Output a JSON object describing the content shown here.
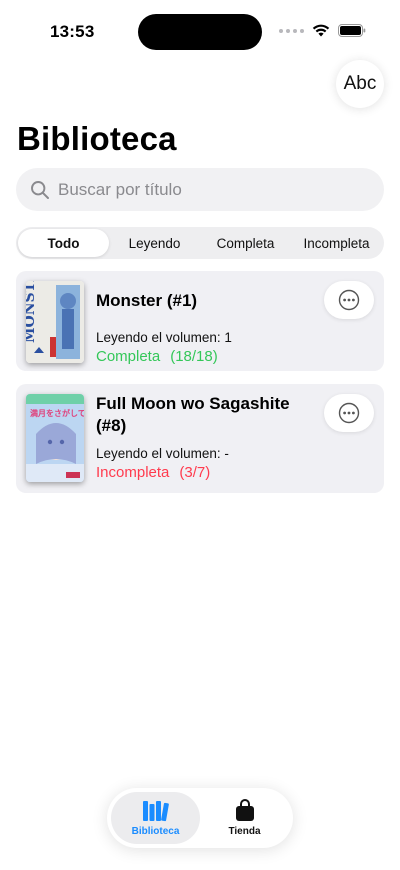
{
  "status_bar": {
    "time": "13:53"
  },
  "toolbar": {
    "font_button_label": "Abc"
  },
  "header": {
    "title": "Biblioteca"
  },
  "search": {
    "placeholder": "Buscar por título"
  },
  "filters": {
    "segments": [
      "Todo",
      "Leyendo",
      "Completa",
      "Incompleta"
    ],
    "selected": "Todo"
  },
  "library": {
    "items": [
      {
        "title": "Monster (#1)",
        "reading": "Leyendo el volumen: 1",
        "status": "Completa",
        "count": "(18/18)",
        "status_color": "#34c759",
        "cover_text": "MONSTER"
      },
      {
        "title": "Full Moon wo Sagashite (#8)",
        "reading": "Leyendo el volumen: -",
        "status": "Incompleta",
        "count": "(3/7)",
        "status_color": "#ff3b4e",
        "cover_text": "満月をさがして"
      }
    ]
  },
  "tabbar": {
    "tabs": [
      {
        "label": "Biblioteca",
        "icon": "books-icon",
        "active": true
      },
      {
        "label": "Tienda",
        "icon": "bag-icon",
        "active": false
      }
    ],
    "accent": "#1a8cff"
  }
}
